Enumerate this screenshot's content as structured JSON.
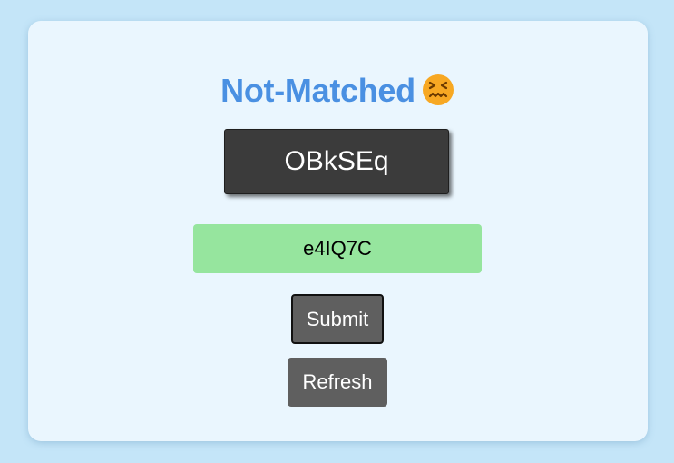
{
  "status": {
    "title": "Not-Matched",
    "icon": "confounded-face-icon",
    "title_color": "#4a90e2"
  },
  "captcha": {
    "text": "OBkSEq"
  },
  "answer": {
    "value": "e4IQ7C",
    "background_color": "#96e59e"
  },
  "buttons": {
    "submit_label": "Submit",
    "refresh_label": "Refresh"
  }
}
